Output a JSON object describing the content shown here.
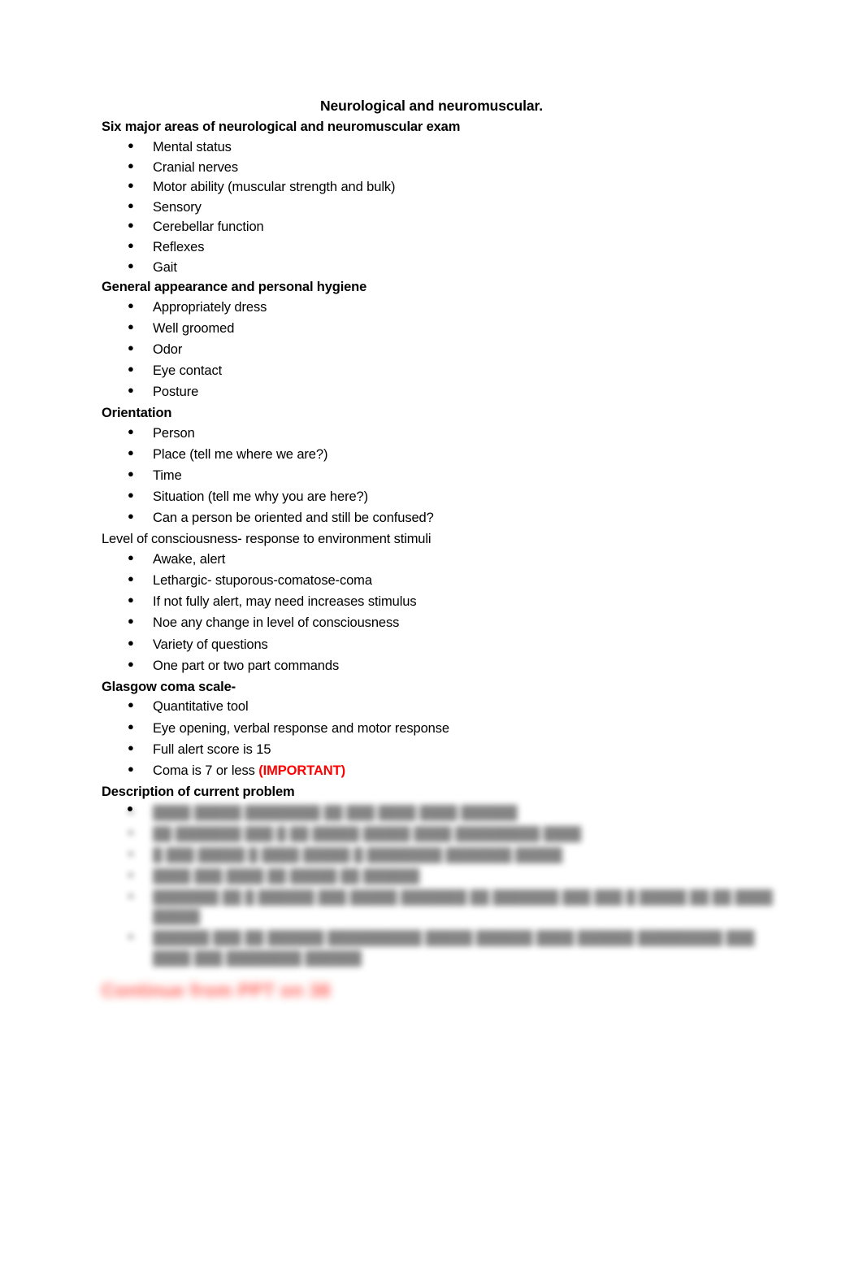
{
  "document": {
    "title": "Neurological and neuromuscular.",
    "sections": [
      {
        "heading": "Six major areas of neurological and neuromuscular exam",
        "heading_bold": true,
        "items": [
          "Mental status",
          "Cranial nerves",
          "Motor ability (muscular strength and bulk)",
          "Sensory",
          "Cerebellar function",
          "Reflexes",
          "Gait"
        ]
      },
      {
        "heading": "General appearance and personal hygiene",
        "heading_bold": true,
        "items": [
          "Appropriately dress",
          "Well groomed",
          "Odor",
          "Eye contact",
          "Posture"
        ]
      },
      {
        "heading": "Orientation",
        "heading_bold": true,
        "items": [
          "Person",
          "Place (tell me where we are?)",
          "Time",
          "Situation (tell me why you are here?)",
          "Can a person be oriented and still be confused?"
        ]
      },
      {
        "heading": "Level of consciousness- response to environment stimuli",
        "heading_bold": false,
        "items": [
          "Awake, alert",
          "Lethargic- stuporous-comatose-coma",
          "If not fully alert, may need increases stimulus",
          "Noe any change in level of consciousness",
          "Variety of questions",
          "One part or two part commands"
        ]
      },
      {
        "heading": "Glasgow coma scale-",
        "heading_bold": true,
        "items": [
          "Quantitative tool",
          "Eye opening, verbal response and motor response",
          "Full alert score is 15"
        ],
        "last_item": {
          "text": "Coma is 7 or less ",
          "emphasis": "(IMPORTANT)",
          "emphasis_color": "#FF0000"
        }
      },
      {
        "heading": "Description of current problem",
        "heading_bold": true,
        "redacted": true,
        "items": [
          "████ █████ ████████ ██ ███ ████ ████ ██████",
          "██ ███████ ███ █ ██ █████ █████ ████ █████████ ████",
          "█ ███ █████ █ ████ █████  █ ████████ ███████ █████",
          "████ ███ ████ ██ █████ ██ ██████",
          "███████ ██ █ ██████ ███ █████ ███████ ██ ███████ ███ ███ █ █████ ██ ██ ████ █████",
          "██████ ███  ██ ██████  ██████████ █████ ██████ ████ ██████ █████████ ███ ████ ███ ████████ ██████"
        ]
      }
    ],
    "closing_note": "Continue from PPT on 38"
  }
}
